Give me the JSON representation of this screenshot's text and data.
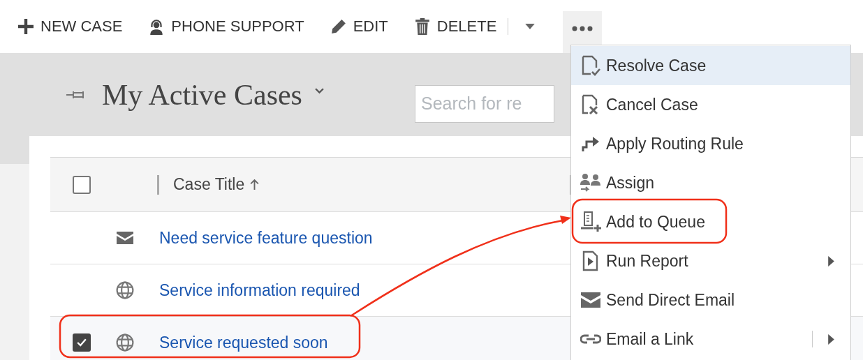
{
  "toolbar": [
    {
      "label": "NEW CASE"
    },
    {
      "label": "PHONE SUPPORT"
    },
    {
      "label": "EDIT"
    },
    {
      "label": "DELETE"
    }
  ],
  "more_menu_open": true,
  "view": {
    "title": "My Active Cases"
  },
  "search": {
    "placeholder": "Search for re"
  },
  "table": {
    "columns": [
      {
        "label": "Case Title"
      }
    ],
    "all_checked": false,
    "rows": [
      {
        "title": "Need service feature question",
        "checked": false
      },
      {
        "title": "Service information required",
        "checked": false
      },
      {
        "title": "Service requested soon",
        "checked": true
      }
    ]
  },
  "menu": [
    {
      "label": "Resolve Case",
      "selected": true,
      "submenu": false
    },
    {
      "label": "Cancel Case",
      "selected": false,
      "submenu": false
    },
    {
      "label": "Apply Routing Rule",
      "selected": false,
      "submenu": false
    },
    {
      "label": "Assign",
      "selected": false,
      "submenu": false
    },
    {
      "label": "Add to Queue",
      "selected": false,
      "submenu": false
    },
    {
      "label": "Run Report",
      "selected": false,
      "submenu": true
    },
    {
      "label": "Send Direct Email",
      "selected": false,
      "submenu": false
    },
    {
      "label": "Email a Link",
      "selected": false,
      "submenu": true
    }
  ]
}
